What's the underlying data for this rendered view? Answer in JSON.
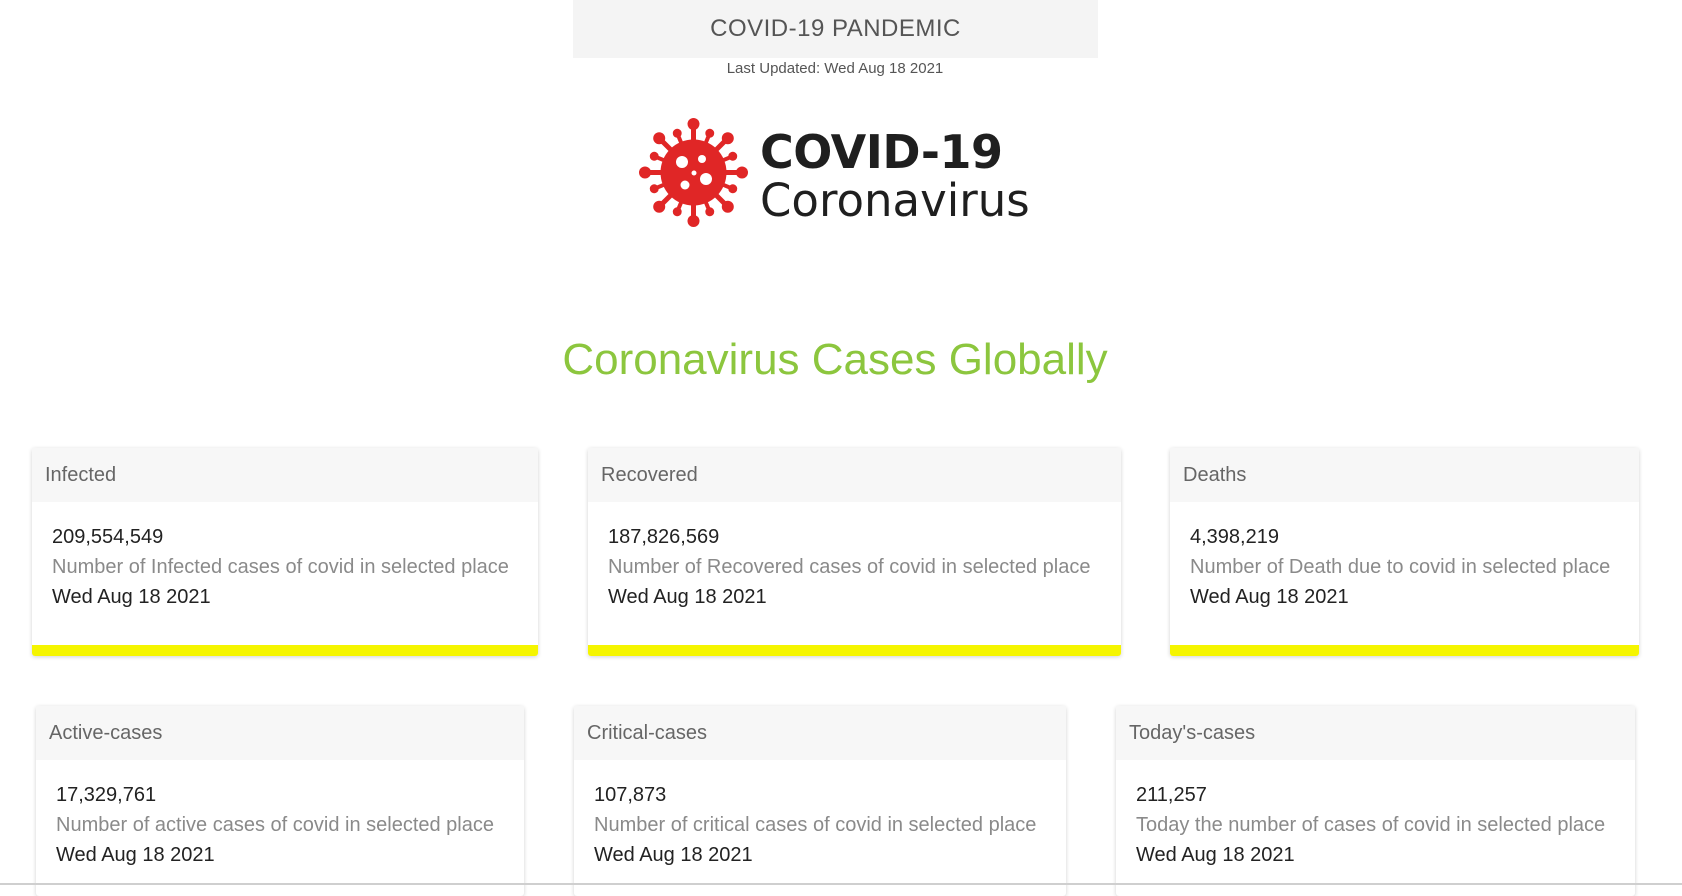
{
  "header": {
    "title": "COVID-19 PANDEMIC",
    "last_updated": "Last Updated: Wed Aug 18 2021"
  },
  "logo": {
    "line1": "COVID-19",
    "line2": "Coronavirus",
    "icon": "virus-icon",
    "color": "#e02626"
  },
  "headline": "Coronavirus Cases Globally",
  "accent_color": "#8cc63e",
  "bar_color": "#f5f500",
  "cards": [
    {
      "title": "Infected",
      "value": "209,554,549",
      "description": "Number of Infected cases of covid in selected place",
      "date": "Wed Aug 18 2021"
    },
    {
      "title": "Recovered",
      "value": "187,826,569",
      "description": "Number of Recovered cases of covid in selected place",
      "date": "Wed Aug 18 2021"
    },
    {
      "title": "Deaths",
      "value": "4,398,219",
      "description": "Number of Death due to covid in selected place",
      "date": "Wed Aug 18 2021"
    },
    {
      "title": "Active-cases",
      "value": "17,329,761",
      "description": "Number of active cases of covid in selected place",
      "date": "Wed Aug 18 2021"
    },
    {
      "title": "Critical-cases",
      "value": "107,873",
      "description": "Number of critical cases of covid in selected place",
      "date": "Wed Aug 18 2021"
    },
    {
      "title": "Today's-cases",
      "value": "211,257",
      "description": "Today the number of cases of covid in selected place",
      "date": "Wed Aug 18 2021"
    }
  ]
}
